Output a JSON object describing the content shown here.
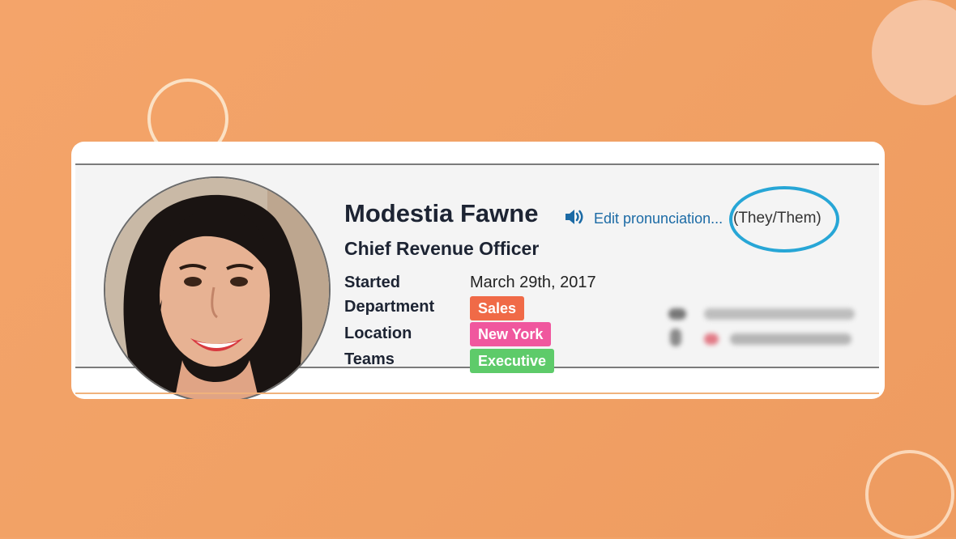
{
  "profile": {
    "name": "Modestia Fawne",
    "edit_pronunciation": "Edit pronunciation...",
    "pronouns": "(They/Them)",
    "title": "Chief Revenue Officer"
  },
  "fields": {
    "started": {
      "label": "Started",
      "value": "March 29th, 2017"
    },
    "department": {
      "label": "Department",
      "value": "Sales",
      "color": "#f06a47"
    },
    "location": {
      "label": "Location",
      "value": "New York",
      "color": "#f0579e"
    },
    "teams": {
      "label": "Teams",
      "value": "Executive",
      "color": "#5ecb6a"
    }
  },
  "colors": {
    "background": "#f1a165",
    "link": "#1b6aa5",
    "highlight_ring": "#27a6d6"
  },
  "icons": {
    "speaker": "speaker-icon",
    "email": "email-icon",
    "phone": "phone-icon"
  }
}
